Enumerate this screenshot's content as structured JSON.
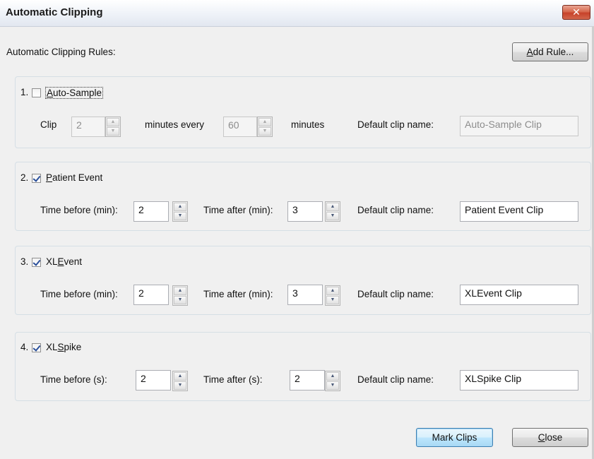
{
  "window": {
    "title": "Automatic Clipping",
    "close_symbol": "✕"
  },
  "header": {
    "rules_label": "Automatic Clipping Rules:"
  },
  "add_rule": {
    "pre": "",
    "accel": "A",
    "post": "dd Rule..."
  },
  "rules": [
    {
      "number": "1.",
      "checked": false,
      "name_pre": "",
      "name_accel": "A",
      "name_post": "uto-Sample",
      "clip_label": "Clip",
      "clip_value": "2",
      "minutes_every_label": "minutes every",
      "every_value": "60",
      "minutes_label": "minutes",
      "default_name_label": "Default clip name:",
      "default_name_value": "Auto-Sample Clip"
    },
    {
      "number": "2.",
      "checked": true,
      "name_pre": "",
      "name_accel": "P",
      "name_post": "atient Event",
      "before_label": "Time before (min):",
      "before_value": "2",
      "after_label": "Time after (min):",
      "after_value": "3",
      "default_name_label": "Default clip name:",
      "default_name_value": "Patient Event Clip"
    },
    {
      "number": "3.",
      "checked": true,
      "name_pre": "XL",
      "name_accel": "E",
      "name_post": "vent",
      "before_label": "Time before (min):",
      "before_value": "2",
      "after_label": "Time after (min):",
      "after_value": "3",
      "default_name_label": "Default clip name:",
      "default_name_value": "XLEvent Clip"
    },
    {
      "number": "4.",
      "checked": true,
      "name_pre": "XL",
      "name_accel": "S",
      "name_post": "pike",
      "before_label": "Time before (s):",
      "before_value": "2",
      "after_label": "Time after (s):",
      "after_value": "2",
      "default_name_label": "Default clip name:",
      "default_name_value": "XLSpike Clip"
    }
  ],
  "footer": {
    "mark_clips_label": "Mark Clips",
    "close_accel": "C",
    "close_post": "lose"
  },
  "icons": {
    "spin_up": "▲",
    "spin_down": "▼"
  }
}
